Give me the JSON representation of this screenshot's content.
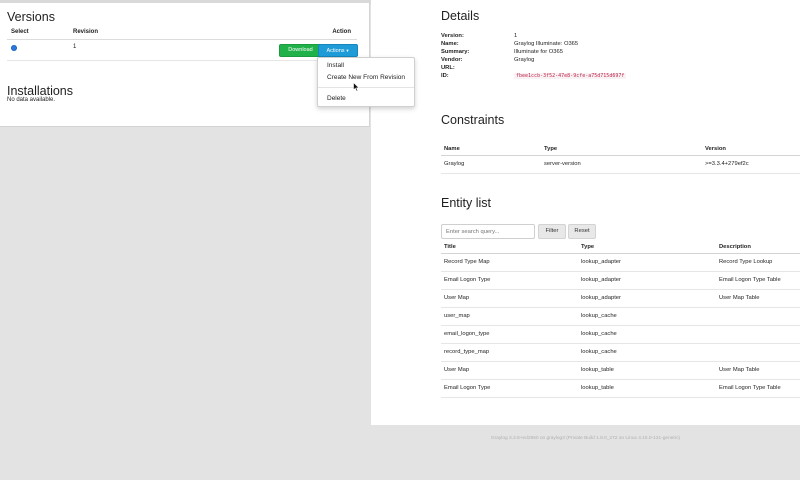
{
  "versions": {
    "title": "Versions",
    "columns": {
      "select": "Select",
      "revision": "Revision",
      "action": "Action"
    },
    "rows": [
      {
        "revision": "1",
        "download_label": "Download",
        "actions_label": "Actions"
      }
    ],
    "dropdown": {
      "install": "Install",
      "create_new": "Create New From Revision",
      "delete": "Delete"
    }
  },
  "installations": {
    "title": "Installations",
    "empty": "No data available."
  },
  "details": {
    "title": "Details",
    "fields": [
      {
        "label": "Version:",
        "value": "1"
      },
      {
        "label": "Name:",
        "value": "Graylog Illuminate: O365"
      },
      {
        "label": "Summary:",
        "value": "Illuminate for O365"
      },
      {
        "label": "Vendor:",
        "value": "Graylog"
      },
      {
        "label": "URL:",
        "value": ""
      },
      {
        "label": "ID:",
        "value": "fbee1ccb-3f52-47e8-9cfe-a75d715d697f"
      }
    ]
  },
  "constraints": {
    "title": "Constraints",
    "columns": {
      "name": "Name",
      "type": "Type",
      "version": "Version"
    },
    "rows": [
      {
        "name": "Graylog",
        "type": "server-version",
        "version": ">=3.3.4+279ef2c"
      }
    ]
  },
  "entity_list": {
    "title": "Entity list",
    "search_placeholder": "Enter search query...",
    "filter_label": "Filter",
    "reset_label": "Reset",
    "columns": {
      "title": "Title",
      "type": "Type",
      "description": "Description"
    },
    "rows": [
      {
        "title": "Record Type Map",
        "type": "lookup_adapter",
        "description": "Record Type Lookup"
      },
      {
        "title": "Email Logon Type",
        "type": "lookup_adapter",
        "description": "Email Logon Type Table"
      },
      {
        "title": "User Map",
        "type": "lookup_adapter",
        "description": "User Map Table"
      },
      {
        "title": "user_map",
        "type": "lookup_cache",
        "description": ""
      },
      {
        "title": "email_logon_type",
        "type": "lookup_cache",
        "description": ""
      },
      {
        "title": "record_type_map",
        "type": "lookup_cache",
        "description": ""
      },
      {
        "title": "User Map",
        "type": "lookup_table",
        "description": "User Map Table"
      },
      {
        "title": "Email Logon Type",
        "type": "lookup_table",
        "description": "Email Logon Type Table"
      }
    ]
  },
  "footer": {
    "text": "Graylog 3.3.8+ed2980 on graylog3 (Private Build 1.8.0_272 on Linux 4.15.0-121-generic)"
  },
  "colors": {
    "download": "#21b14b",
    "actions": "#1f9cd8",
    "id_code": "#c0264b"
  }
}
